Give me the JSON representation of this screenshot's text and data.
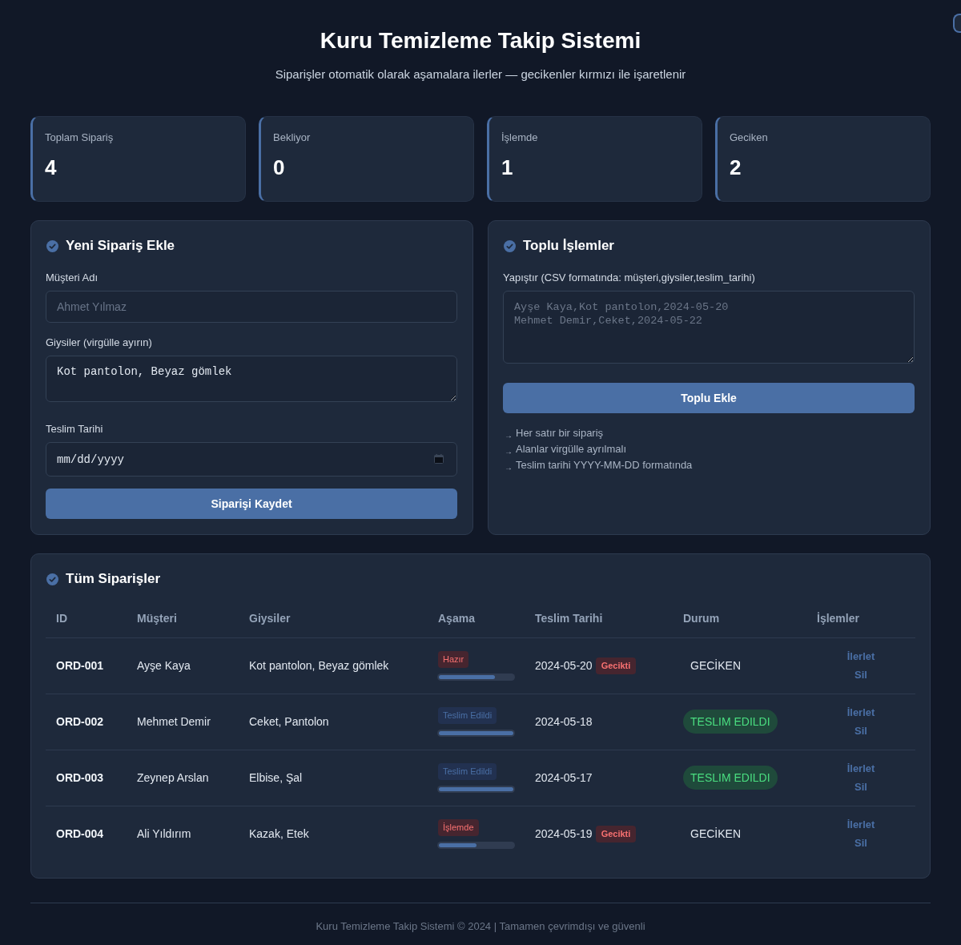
{
  "header": {
    "title": "Kuru Temizleme Takip Sistemi",
    "subtitle": "Siparişler otomatik olarak aşamalara ilerler — gecikenler kırmızı ile işaretlenir"
  },
  "stats": [
    {
      "label": "Toplam Sipariş",
      "value": "4"
    },
    {
      "label": "Bekliyor",
      "value": "0"
    },
    {
      "label": "İşlemde",
      "value": "1"
    },
    {
      "label": "Geciken",
      "value": "2"
    }
  ],
  "new_order": {
    "title": "Yeni Sipariş Ekle",
    "fields": [
      {
        "kind": "text",
        "label": "Müşteri Adı",
        "placeholder": "Ahmet Yılmaz"
      },
      {
        "kind": "textarea",
        "label": "Giysiler (virgülle ayırın)",
        "value": "Kot pantolon, Beyaz gömlek"
      },
      {
        "kind": "date",
        "label": "Teslim Tarihi",
        "placeholder": "mm/dd/yyyy"
      }
    ],
    "button": "Siparişi Kaydet"
  },
  "bulk": {
    "title": "Toplu İşlemler",
    "label": "Yapıştır (CSV formatında: müşteri,giysiler,teslim_tarihi)",
    "placeholder": "Ayşe Kaya,Kot pantolon,2024-05-20\nMehmet Demir,Ceket,2024-05-22",
    "button": "Toplu Ekle",
    "hints": [
      {
        "marker": "→",
        "text": "Her satır bir sipariş"
      },
      {
        "marker": "→",
        "text": "Alanlar virgülle ayrılmalı"
      },
      {
        "marker": "→",
        "text": "Teslim tarihi YYYY-MM-DD formatında"
      }
    ]
  },
  "orders": {
    "title": "Tüm Siparişler",
    "columns": [
      "ID",
      "Müşteri",
      "Giysiler",
      "Aşama",
      "Teslim Tarihi",
      "Durum",
      "İşlemler"
    ],
    "rows": [
      {
        "id": "ORD-001",
        "customer": "Ayşe Kaya",
        "items": "Kot pantolon, Beyaz gömlek",
        "overdue": true,
        "stage": {
          "label": "Hazır",
          "level": 0.75
        },
        "due": "2024-05-20",
        "late_tag": "Gecikti",
        "status": {
          "kind": "late",
          "text": "GECİKEN"
        },
        "advance_link": "İlerlet",
        "delete_link": "Sil"
      },
      {
        "id": "ORD-002",
        "customer": "Mehmet Demir",
        "items": "Ceket, Pantolon",
        "overdue": false,
        "stage": {
          "label": "Teslim Edildi",
          "level": 1
        },
        "due": "2024-05-18",
        "status": {
          "kind": "delivered",
          "text": "TESLIM EDILDI"
        },
        "advance_link": "İlerlet",
        "delete_link": "Sil"
      },
      {
        "id": "ORD-003",
        "customer": "Zeynep Arslan",
        "items": "Elbise, Şal",
        "overdue": false,
        "stage": {
          "label": "Teslim Edildi",
          "level": 1
        },
        "due": "2024-05-17",
        "status": {
          "kind": "delivered",
          "text": "TESLIM EDILDI"
        },
        "advance_link": "İlerlet",
        "delete_link": "Sil"
      },
      {
        "id": "ORD-004",
        "customer": "Ali Yıldırım",
        "items": "Kazak, Etek",
        "overdue": true,
        "stage": {
          "label": "İşlemde",
          "level": 0.5
        },
        "due": "2024-05-19",
        "late_tag": "Gecikti",
        "status": {
          "kind": "late",
          "text": "GECİKEN"
        },
        "advance_link": "İlerlet",
        "delete_link": "Sil"
      }
    ]
  },
  "footer": "Kuru Temizleme Takip Sistemi © 2024 | Tamamen çevrimdışı ve güvenli"
}
